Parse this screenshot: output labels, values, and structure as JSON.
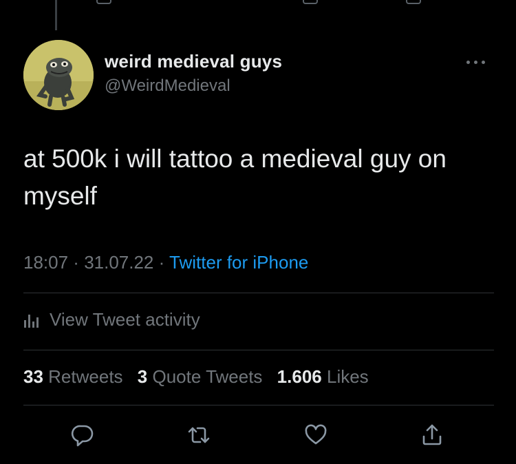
{
  "profile": {
    "name": "weird medieval guys",
    "handle": "@WeirdMedieval",
    "avatar_icon": "medieval-frog-avatar"
  },
  "tweet": {
    "text": "at 500k i will tattoo a medieval guy on myself",
    "time": "18:07",
    "date": "31.07.22",
    "separator": " · ",
    "source": "Twitter for iPhone"
  },
  "activity": {
    "label": "View Tweet activity",
    "icon": "analytics-icon"
  },
  "stats": {
    "retweets_count": "33",
    "retweets_label": "Retweets",
    "quotes_count": "3",
    "quotes_label": "Quote Tweets",
    "likes_count": "1.606",
    "likes_label": "Likes"
  },
  "actions": [
    "reply-icon",
    "retweet-icon",
    "like-icon",
    "share-icon"
  ],
  "colors": {
    "background": "#000000",
    "text": "#e7e9ea",
    "muted": "#71767b",
    "link": "#1d9bf0",
    "divider": "#2f3336"
  }
}
